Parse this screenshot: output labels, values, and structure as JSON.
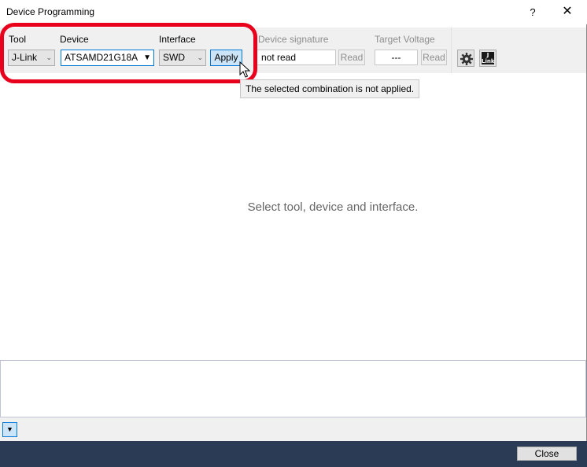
{
  "window": {
    "title": "Device Programming",
    "help_glyph": "?",
    "close_glyph": "✕"
  },
  "toolbar": {
    "tool_label": "Tool",
    "tool_value": "J-Link",
    "device_label": "Device",
    "device_value": "ATSAMD21G18A",
    "interface_label": "Interface",
    "interface_value": "SWD",
    "apply_label": "Apply",
    "signature_label": "Device signature",
    "signature_value": "not read",
    "signature_read_label": "Read",
    "voltage_label": "Target Voltage",
    "voltage_value": "---",
    "voltage_read_label": "Read",
    "settings_icon": "gear-icon",
    "jlink_icon": "jlink-icon",
    "jlink_icon_text": "J Link"
  },
  "tooltip": {
    "text": "The selected combination is not applied."
  },
  "main": {
    "message": "Select tool, device and interface."
  },
  "bottom": {
    "expand_glyph": "▼"
  },
  "footer": {
    "close_label": "Close"
  },
  "colors": {
    "highlight_ring": "#e8001c",
    "footer_bg": "#2b3a55",
    "accent": "#0078d7"
  }
}
